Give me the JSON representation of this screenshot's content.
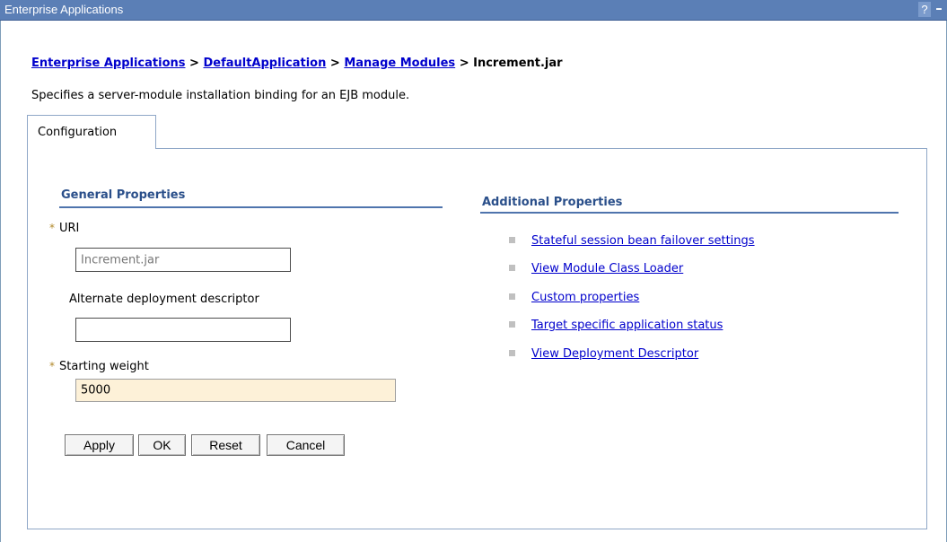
{
  "window": {
    "title": "Enterprise Applications",
    "help_icon": "question-mark-icon",
    "minimize_icon": "minimize-icon"
  },
  "breadcrumb": {
    "items": [
      "Enterprise Applications",
      "DefaultApplication",
      "Manage Modules"
    ],
    "separator": ">",
    "current": "Increment.jar"
  },
  "description": "Specifies a server-module installation binding for an EJB module.",
  "tabs": [
    {
      "label": "Configuration",
      "active": true
    }
  ],
  "general_properties": {
    "heading": "General Properties",
    "required_marker": "*",
    "uri": {
      "label": "URI",
      "value": "Increment.jar",
      "required": true,
      "readonly": true
    },
    "alt_dd": {
      "label": "Alternate deployment descriptor",
      "value": "",
      "required": false
    },
    "starting_weight": {
      "label": "Starting weight",
      "value": "5000",
      "required": true
    }
  },
  "buttons": {
    "apply": "Apply",
    "ok": "OK",
    "reset": "Reset",
    "cancel": "Cancel"
  },
  "additional_properties": {
    "heading": "Additional Properties",
    "links": [
      "Stateful session bean failover settings",
      "View Module Class Loader",
      "Custom properties",
      "Target specific application status",
      "View Deployment Descriptor"
    ]
  },
  "colors": {
    "titlebar": "#5b7fb6",
    "link": "#0000cc",
    "heading": "#2a4f8a",
    "required_field_bg": "#fdf1d8"
  }
}
